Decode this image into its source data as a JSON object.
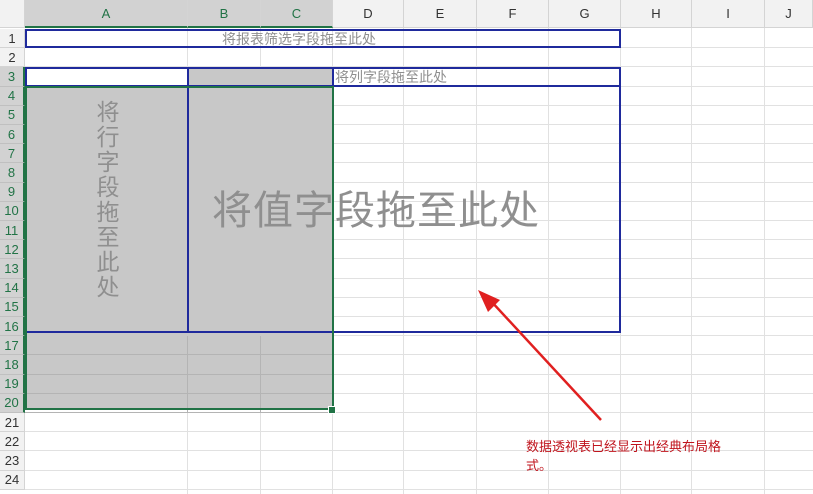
{
  "columns": [
    "A",
    "B",
    "C",
    "D",
    "E",
    "F",
    "G",
    "H",
    "I",
    "J"
  ],
  "rows": [
    "1",
    "2",
    "3",
    "4",
    "5",
    "6",
    "7",
    "8",
    "9",
    "10",
    "11",
    "12",
    "13",
    "14",
    "15",
    "16",
    "17",
    "18",
    "19",
    "20",
    "21",
    "22",
    "23",
    "24"
  ],
  "pivot": {
    "filter_drop": "将报表筛选字段拖至此处",
    "column_drop": "将列字段拖至此处",
    "row_drop": "将行字段拖至此处",
    "value_drop": "将值字段拖至此处"
  },
  "annotation": {
    "line1": "数据透视表已经显示出经典布局格",
    "line2": "式。"
  },
  "colors": {
    "pivot_border": "#1f2a9c",
    "selection": "#217346",
    "note": "#c0141d",
    "arrow": "#e02020"
  }
}
